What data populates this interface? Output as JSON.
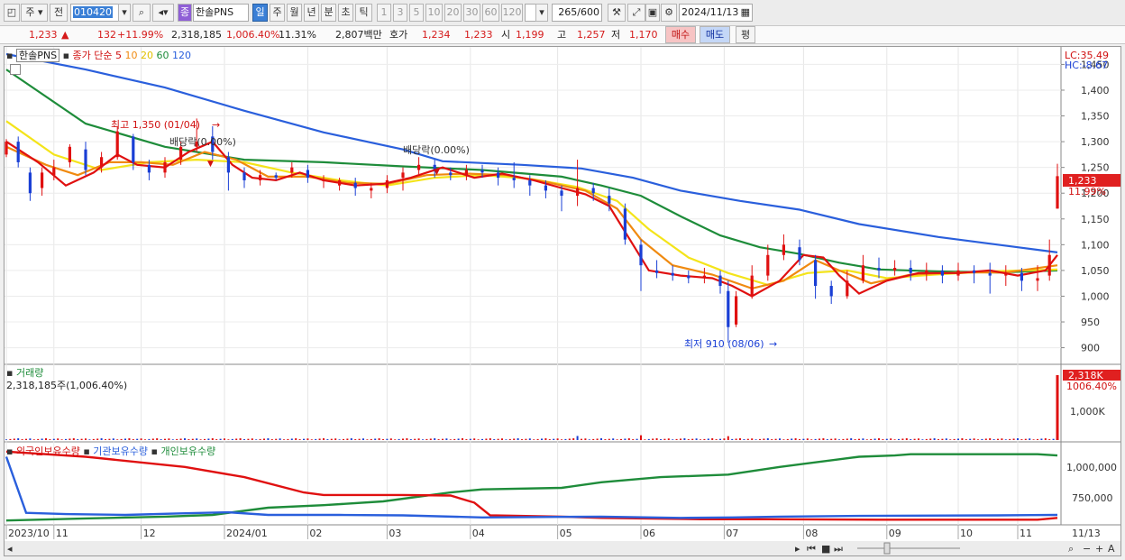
{
  "toolbar": {
    "type_label": "주",
    "type2_label": "전",
    "code": "010420",
    "name_badge": "종",
    "stock_name": "한솔PNS",
    "periods": [
      "일",
      "주",
      "월",
      "년",
      "분",
      "초",
      "틱"
    ],
    "active_period": "일",
    "intervals": [
      "1",
      "3",
      "5",
      "10",
      "20",
      "30",
      "60",
      "120"
    ],
    "count": "265",
    "count_total": "/600",
    "date": "2024/11/13"
  },
  "quote": {
    "price": "1,233",
    "change_arrow": "▲",
    "change": "132",
    "change_pct": "+11.99%",
    "volume": "2,318,185",
    "volume_ratio": "1,006.40%",
    "turnover": "11.31%",
    "amount": "2,807백만",
    "ask_label": "호가",
    "ask1": "1,234",
    "ask2": "1,233",
    "open_label": "시",
    "open": "1,199",
    "high_label": "고",
    "high": "1,257",
    "low_label": "저",
    "low": "1,170",
    "buy_btn": "매수",
    "sell_btn": "매도",
    "eval_btn": "평"
  },
  "price_panel": {
    "stock_label": "한솔PNS",
    "ma_label": "종가 단순",
    "ma_periods": [
      "5",
      "10",
      "20",
      "60",
      "120"
    ],
    "ma_colors": [
      "#e01010",
      "#f08a10",
      "#f4e41a",
      "#1e8c3a",
      "#2a5fdc"
    ],
    "lc_label": "LC:35.49",
    "hc_label": "HC:-8.67",
    "high_annot": "최고 1,350 (01/04)",
    "low_annot": "최저 910 (08/06)",
    "div1": "배당락(0.00%)",
    "div2": "배당락(0.00%)",
    "y_ticks": [
      "1,450",
      "1,400",
      "1,350",
      "1,300",
      "1,250",
      "1,200",
      "1,150",
      "1,100",
      "1,050",
      "1,000",
      "950",
      "900"
    ],
    "last_price": "1,233",
    "last_pct": "11.99%"
  },
  "volume_panel": {
    "label": "거래량",
    "value": "2,318,185주(1,006.40%)",
    "tick": "1,000K",
    "last": "2,318K",
    "last_pct": "1006.40%"
  },
  "holding_panel": {
    "labels": [
      "외국인보유수량",
      "기관보유수량",
      "개인보유수량"
    ],
    "colors": [
      "#e01010",
      "#2a5fdc",
      "#1e8c3a"
    ],
    "ticks": [
      "1,000,000",
      "750,000"
    ]
  },
  "x_axis": {
    "labels": [
      "2023/10",
      "11",
      "12",
      "2024/01",
      "02",
      "03",
      "04",
      "05",
      "06",
      "07",
      "08",
      "09",
      "10",
      "11"
    ],
    "last_date": "11/13"
  },
  "chart_data": {
    "type": "candlestick",
    "price_range": [
      880,
      1470
    ],
    "ma5": [
      [
        0,
        1300
      ],
      [
        8,
        1260
      ],
      [
        15,
        1215
      ],
      [
        22,
        1240
      ],
      [
        28,
        1275
      ],
      [
        33,
        1255
      ],
      [
        40,
        1250
      ],
      [
        46,
        1280
      ],
      [
        52,
        1300
      ],
      [
        57,
        1255
      ],
      [
        62,
        1230
      ],
      [
        68,
        1225
      ],
      [
        74,
        1240
      ],
      [
        80,
        1225
      ],
      [
        88,
        1215
      ],
      [
        95,
        1218
      ],
      [
        102,
        1230
      ],
      [
        110,
        1250
      ],
      [
        118,
        1230
      ],
      [
        125,
        1238
      ],
      [
        133,
        1225
      ],
      [
        140,
        1210
      ],
      [
        146,
        1198
      ],
      [
        152,
        1175
      ],
      [
        158,
        1100
      ],
      [
        162,
        1050
      ],
      [
        170,
        1040
      ],
      [
        178,
        1035
      ],
      [
        183,
        1020
      ],
      [
        188,
        1000
      ],
      [
        195,
        1030
      ],
      [
        201,
        1080
      ],
      [
        206,
        1075
      ],
      [
        210,
        1040
      ],
      [
        215,
        1005
      ],
      [
        222,
        1030
      ],
      [
        230,
        1045
      ],
      [
        240,
        1045
      ],
      [
        248,
        1050
      ],
      [
        255,
        1040
      ],
      [
        262,
        1050
      ],
      [
        265,
        1080
      ]
    ],
    "ma10": [
      [
        0,
        1290
      ],
      [
        10,
        1255
      ],
      [
        18,
        1235
      ],
      [
        26,
        1260
      ],
      [
        34,
        1260
      ],
      [
        42,
        1255
      ],
      [
        50,
        1280
      ],
      [
        58,
        1265
      ],
      [
        66,
        1232
      ],
      [
        76,
        1232
      ],
      [
        86,
        1220
      ],
      [
        96,
        1218
      ],
      [
        106,
        1235
      ],
      [
        116,
        1238
      ],
      [
        126,
        1235
      ],
      [
        136,
        1222
      ],
      [
        146,
        1205
      ],
      [
        154,
        1170
      ],
      [
        160,
        1110
      ],
      [
        168,
        1060
      ],
      [
        178,
        1042
      ],
      [
        188,
        1015
      ],
      [
        196,
        1030
      ],
      [
        204,
        1070
      ],
      [
        210,
        1050
      ],
      [
        218,
        1025
      ],
      [
        228,
        1042
      ],
      [
        240,
        1046
      ],
      [
        252,
        1046
      ],
      [
        265,
        1060
      ]
    ],
    "ma20": [
      [
        0,
        1340
      ],
      [
        12,
        1275
      ],
      [
        24,
        1245
      ],
      [
        36,
        1260
      ],
      [
        48,
        1265
      ],
      [
        60,
        1260
      ],
      [
        72,
        1240
      ],
      [
        84,
        1225
      ],
      [
        96,
        1215
      ],
      [
        108,
        1230
      ],
      [
        120,
        1235
      ],
      [
        132,
        1228
      ],
      [
        144,
        1212
      ],
      [
        154,
        1185
      ],
      [
        162,
        1130
      ],
      [
        172,
        1075
      ],
      [
        182,
        1045
      ],
      [
        192,
        1022
      ],
      [
        202,
        1045
      ],
      [
        212,
        1050
      ],
      [
        222,
        1035
      ],
      [
        234,
        1042
      ],
      [
        248,
        1048
      ],
      [
        265,
        1052
      ]
    ],
    "ma60": [
      [
        0,
        1440
      ],
      [
        20,
        1335
      ],
      [
        40,
        1290
      ],
      [
        60,
        1265
      ],
      [
        80,
        1260
      ],
      [
        100,
        1252
      ],
      [
        120,
        1245
      ],
      [
        140,
        1232
      ],
      [
        150,
        1215
      ],
      [
        160,
        1195
      ],
      [
        170,
        1155
      ],
      [
        180,
        1118
      ],
      [
        190,
        1095
      ],
      [
        200,
        1082
      ],
      [
        210,
        1065
      ],
      [
        220,
        1052
      ],
      [
        235,
        1048
      ],
      [
        250,
        1046
      ],
      [
        265,
        1050
      ]
    ],
    "ma120": [
      [
        0,
        1470
      ],
      [
        20,
        1440
      ],
      [
        40,
        1405
      ],
      [
        60,
        1360
      ],
      [
        80,
        1318
      ],
      [
        100,
        1285
      ],
      [
        110,
        1262
      ],
      [
        130,
        1255
      ],
      [
        145,
        1248
      ],
      [
        158,
        1230
      ],
      [
        170,
        1205
      ],
      [
        185,
        1185
      ],
      [
        200,
        1168
      ],
      [
        215,
        1140
      ],
      [
        235,
        1115
      ],
      [
        255,
        1095
      ],
      [
        265,
        1085
      ]
    ],
    "candles": [
      [
        0,
        1275,
        1300,
        1305,
        1270
      ],
      [
        3,
        1300,
        1260,
        1310,
        1250
      ],
      [
        6,
        1240,
        1200,
        1250,
        1185
      ],
      [
        9,
        1210,
        1240,
        1250,
        1195
      ],
      [
        12,
        1235,
        1250,
        1265,
        1225
      ],
      [
        16,
        1260,
        1290,
        1295,
        1250
      ],
      [
        20,
        1285,
        1245,
        1300,
        1235
      ],
      [
        24,
        1250,
        1270,
        1280,
        1240
      ],
      [
        28,
        1270,
        1320,
        1330,
        1265
      ],
      [
        32,
        1310,
        1260,
        1315,
        1245
      ],
      [
        36,
        1255,
        1240,
        1265,
        1225
      ],
      [
        40,
        1240,
        1260,
        1270,
        1230
      ],
      [
        44,
        1265,
        1290,
        1300,
        1255
      ],
      [
        48,
        1290,
        1300,
        1345,
        1280
      ],
      [
        52,
        1310,
        1280,
        1330,
        1265
      ],
      [
        56,
        1270,
        1240,
        1280,
        1205
      ],
      [
        60,
        1240,
        1225,
        1250,
        1210
      ],
      [
        64,
        1225,
        1235,
        1245,
        1215
      ],
      [
        68,
        1235,
        1230,
        1240,
        1225
      ],
      [
        72,
        1240,
        1250,
        1260,
        1230
      ],
      [
        76,
        1245,
        1230,
        1255,
        1220
      ],
      [
        80,
        1225,
        1225,
        1235,
        1210
      ],
      [
        84,
        1215,
        1225,
        1230,
        1205
      ],
      [
        88,
        1220,
        1210,
        1230,
        1195
      ],
      [
        92,
        1205,
        1210,
        1220,
        1190
      ],
      [
        96,
        1210,
        1225,
        1235,
        1200
      ],
      [
        100,
        1230,
        1240,
        1250,
        1205
      ],
      [
        104,
        1245,
        1255,
        1270,
        1235
      ],
      [
        108,
        1255,
        1245,
        1265,
        1230
      ],
      [
        112,
        1240,
        1235,
        1250,
        1225
      ],
      [
        116,
        1235,
        1245,
        1255,
        1225
      ],
      [
        120,
        1245,
        1240,
        1255,
        1230
      ],
      [
        124,
        1240,
        1230,
        1250,
        1215
      ],
      [
        128,
        1230,
        1225,
        1260,
        1210
      ],
      [
        132,
        1225,
        1215,
        1235,
        1195
      ],
      [
        136,
        1215,
        1205,
        1225,
        1190
      ],
      [
        140,
        1205,
        1195,
        1215,
        1165
      ],
      [
        144,
        1195,
        1210,
        1265,
        1175
      ],
      [
        148,
        1210,
        1200,
        1220,
        1185
      ],
      [
        152,
        1195,
        1180,
        1210,
        1165
      ],
      [
        156,
        1170,
        1110,
        1180,
        1100
      ],
      [
        160,
        1100,
        1060,
        1110,
        1010
      ],
      [
        164,
        1050,
        1045,
        1070,
        1035
      ],
      [
        168,
        1045,
        1040,
        1060,
        1030
      ],
      [
        172,
        1040,
        1035,
        1050,
        1025
      ],
      [
        176,
        1035,
        1040,
        1055,
        1025
      ],
      [
        180,
        1040,
        1020,
        1050,
        1005
      ],
      [
        182,
        1010,
        940,
        1030,
        910
      ],
      [
        184,
        945,
        1000,
        1010,
        940
      ],
      [
        188,
        1000,
        1040,
        1060,
        995
      ],
      [
        192,
        1040,
        1080,
        1100,
        1030
      ],
      [
        196,
        1080,
        1100,
        1120,
        1070
      ],
      [
        200,
        1095,
        1070,
        1110,
        1060
      ],
      [
        204,
        1070,
        1020,
        1080,
        995
      ],
      [
        208,
        1020,
        1000,
        1030,
        985
      ],
      [
        212,
        1000,
        1030,
        1050,
        995
      ],
      [
        216,
        1030,
        1060,
        1080,
        1025
      ],
      [
        220,
        1055,
        1050,
        1075,
        1035
      ],
      [
        224,
        1050,
        1055,
        1070,
        1040
      ],
      [
        228,
        1055,
        1045,
        1070,
        1030
      ],
      [
        232,
        1045,
        1050,
        1065,
        1030
      ],
      [
        236,
        1050,
        1040,
        1060,
        1025
      ],
      [
        240,
        1040,
        1050,
        1065,
        1030
      ],
      [
        244,
        1050,
        1045,
        1060,
        1025
      ],
      [
        248,
        1045,
        1040,
        1065,
        1005
      ],
      [
        252,
        1040,
        1045,
        1060,
        1020
      ],
      [
        256,
        1045,
        1030,
        1055,
        1010
      ],
      [
        260,
        1030,
        1035,
        1060,
        1010
      ],
      [
        263,
        1040,
        1080,
        1110,
        1030
      ],
      [
        265,
        1170,
        1233,
        1257,
        1170
      ]
    ],
    "volume_spike_last": 2318185,
    "foreign_hold": [
      [
        0,
        1100000
      ],
      [
        20,
        1080000
      ],
      [
        45,
        1040000
      ],
      [
        60,
        1000000
      ],
      [
        75,
        940000
      ],
      [
        80,
        930000
      ],
      [
        100,
        930000
      ],
      [
        112,
        928000
      ],
      [
        118,
        900000
      ],
      [
        122,
        850000
      ],
      [
        140,
        845000
      ],
      [
        150,
        840000
      ],
      [
        175,
        835000
      ],
      [
        178,
        835000
      ],
      [
        192,
        835000
      ],
      [
        220,
        833000
      ],
      [
        250,
        833000
      ],
      [
        260,
        833000
      ],
      [
        265,
        840000
      ]
    ],
    "institution_hold": [
      [
        0,
        1080000
      ],
      [
        5,
        860000
      ],
      [
        15,
        855000
      ],
      [
        30,
        852000
      ],
      [
        44,
        858000
      ],
      [
        56,
        862000
      ],
      [
        66,
        852000
      ],
      [
        84,
        852000
      ],
      [
        100,
        850000
      ],
      [
        120,
        842000
      ],
      [
        150,
        845000
      ],
      [
        170,
        840000
      ],
      [
        183,
        842000
      ],
      [
        195,
        845000
      ],
      [
        215,
        848000
      ],
      [
        250,
        850000
      ],
      [
        265,
        852000
      ]
    ],
    "individual_hold": [
      [
        0,
        830000
      ],
      [
        20,
        838000
      ],
      [
        40,
        845000
      ],
      [
        52,
        852000
      ],
      [
        66,
        880000
      ],
      [
        80,
        890000
      ],
      [
        95,
        905000
      ],
      [
        112,
        940000
      ],
      [
        120,
        952000
      ],
      [
        140,
        958000
      ],
      [
        150,
        980000
      ],
      [
        165,
        1000000
      ],
      [
        182,
        1010000
      ],
      [
        195,
        1040000
      ],
      [
        215,
        1080000
      ],
      [
        224,
        1085000
      ],
      [
        228,
        1090000
      ],
      [
        260,
        1090000
      ],
      [
        265,
        1085000
      ]
    ],
    "holding_range": [
      820000,
      1110000
    ]
  }
}
